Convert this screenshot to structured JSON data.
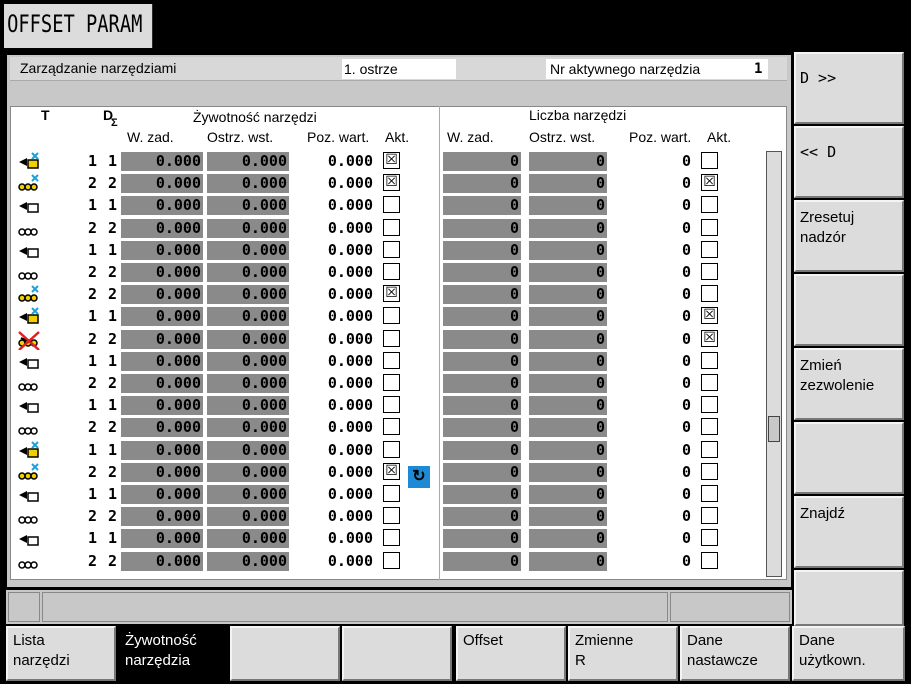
{
  "window": {
    "title": "OFFSET PARAM"
  },
  "header": {
    "section": "Zarządzanie narzędziami",
    "edge": "1. ostrze",
    "active_label": "Nr aktywnego narzędzia",
    "active_value": "1"
  },
  "table": {
    "col_t": "T",
    "col_d": "D",
    "col_d_sub": "Σ",
    "group_life": "Żywotność narzędzi",
    "group_count": "Liczba narzędzi",
    "sub_w": "W. zad.",
    "sub_o": "Ostrz. wst.",
    "sub_p": "Poz. wart.",
    "sub_a": "Akt.",
    "sub_w2": "W. zad.",
    "sub_o2": "Ostrz. wst.",
    "sub_p2": "Poz. wart.",
    "sub_a2": "Akt.",
    "rows": [
      {
        "icon": "drill-icon",
        "mark": "x-y",
        "t": "1",
        "d": "1",
        "w": "0.000",
        "o": "0.000",
        "p": "0.000",
        "akt": true,
        "w2": "0",
        "o2": "0",
        "p2": "0",
        "akt2": false
      },
      {
        "icon": "chain-icon",
        "mark": "x-y",
        "t": "2",
        "d": "2",
        "w": "0.000",
        "o": "0.000",
        "p": "0.000",
        "akt": true,
        "w2": "0",
        "o2": "0",
        "p2": "0",
        "akt2": true
      },
      {
        "icon": "drill-icon",
        "mark": "",
        "t": "1",
        "d": "1",
        "w": "0.000",
        "o": "0.000",
        "p": "0.000",
        "akt": false,
        "w2": "0",
        "o2": "0",
        "p2": "0",
        "akt2": false
      },
      {
        "icon": "chain-icon",
        "mark": "",
        "t": "2",
        "d": "2",
        "w": "0.000",
        "o": "0.000",
        "p": "0.000",
        "akt": false,
        "w2": "0",
        "o2": "0",
        "p2": "0",
        "akt2": false
      },
      {
        "icon": "drill-icon",
        "mark": "",
        "t": "1",
        "d": "1",
        "w": "0.000",
        "o": "0.000",
        "p": "0.000",
        "akt": false,
        "w2": "0",
        "o2": "0",
        "p2": "0",
        "akt2": false
      },
      {
        "icon": "chain-icon",
        "mark": "",
        "t": "2",
        "d": "2",
        "w": "0.000",
        "o": "0.000",
        "p": "0.000",
        "akt": false,
        "w2": "0",
        "o2": "0",
        "p2": "0",
        "akt2": false
      },
      {
        "icon": "chain-icon",
        "mark": "x-y",
        "t": "2",
        "d": "2",
        "w": "0.000",
        "o": "0.000",
        "p": "0.000",
        "akt": true,
        "w2": "0",
        "o2": "0",
        "p2": "0",
        "akt2": false
      },
      {
        "icon": "drill-icon",
        "mark": "x-y",
        "t": "1",
        "d": "1",
        "w": "0.000",
        "o": "0.000",
        "p": "0.000",
        "akt": false,
        "w2": "0",
        "o2": "0",
        "p2": "0",
        "akt2": true
      },
      {
        "icon": "chain-icon",
        "mark": "x-r",
        "t": "2",
        "d": "2",
        "w": "0.000",
        "o": "0.000",
        "p": "0.000",
        "akt": false,
        "w2": "0",
        "o2": "0",
        "p2": "0",
        "akt2": true
      },
      {
        "icon": "drill-icon",
        "mark": "",
        "t": "1",
        "d": "1",
        "w": "0.000",
        "o": "0.000",
        "p": "0.000",
        "akt": false,
        "w2": "0",
        "o2": "0",
        "p2": "0",
        "akt2": false
      },
      {
        "icon": "chain-icon",
        "mark": "",
        "t": "2",
        "d": "2",
        "w": "0.000",
        "o": "0.000",
        "p": "0.000",
        "akt": false,
        "w2": "0",
        "o2": "0",
        "p2": "0",
        "akt2": false
      },
      {
        "icon": "drill-icon",
        "mark": "",
        "t": "1",
        "d": "1",
        "w": "0.000",
        "o": "0.000",
        "p": "0.000",
        "akt": false,
        "w2": "0",
        "o2": "0",
        "p2": "0",
        "akt2": false
      },
      {
        "icon": "chain-icon",
        "mark": "",
        "t": "2",
        "d": "2",
        "w": "0.000",
        "o": "0.000",
        "p": "0.000",
        "akt": false,
        "w2": "0",
        "o2": "0",
        "p2": "0",
        "akt2": false
      },
      {
        "icon": "drill-icon",
        "mark": "x-y",
        "t": "1",
        "d": "1",
        "w": "0.000",
        "o": "0.000",
        "p": "0.000",
        "akt": false,
        "w2": "0",
        "o2": "0",
        "p2": "0",
        "akt2": false
      },
      {
        "icon": "chain-icon",
        "mark": "x-y",
        "t": "2",
        "d": "2",
        "w": "0.000",
        "o": "0.000",
        "p": "0.000",
        "akt": true,
        "w2": "0",
        "o2": "0",
        "p2": "0",
        "akt2": false
      },
      {
        "icon": "drill-icon",
        "mark": "",
        "t": "1",
        "d": "1",
        "w": "0.000",
        "o": "0.000",
        "p": "0.000",
        "akt": false,
        "w2": "0",
        "o2": "0",
        "p2": "0",
        "akt2": false
      },
      {
        "icon": "chain-icon",
        "mark": "",
        "t": "2",
        "d": "2",
        "w": "0.000",
        "o": "0.000",
        "p": "0.000",
        "akt": false,
        "w2": "0",
        "o2": "0",
        "p2": "0",
        "akt2": false
      },
      {
        "icon": "drill-icon",
        "mark": "",
        "t": "1",
        "d": "1",
        "w": "0.000",
        "o": "0.000",
        "p": "0.000",
        "akt": false,
        "w2": "0",
        "o2": "0",
        "p2": "0",
        "akt2": false
      },
      {
        "icon": "chain-icon",
        "mark": "",
        "t": "2",
        "d": "2",
        "w": "0.000",
        "o": "0.000",
        "p": "0.000",
        "akt": false,
        "w2": "0",
        "o2": "0",
        "p2": "0",
        "akt2": false
      }
    ]
  },
  "cursor_glyph": "↻",
  "softkeys_vertical": [
    "D >>",
    "<< D",
    "Zresetuj\nnadzór",
    "",
    "Zmień\nzezwolenie",
    "",
    "Znajdź",
    ""
  ],
  "softkeys_horizontal": [
    "Lista\nnarzędzi",
    "Żywotność\nnarzędzia",
    "",
    "",
    "Offset",
    "Zmienne\nR",
    "Dane\nnastawcze",
    "Dane\nużytkown."
  ],
  "colors": {
    "grey_cell": "#8a8a8a",
    "cursor": "#1e8ad6",
    "selected_softkey": "#000000"
  }
}
